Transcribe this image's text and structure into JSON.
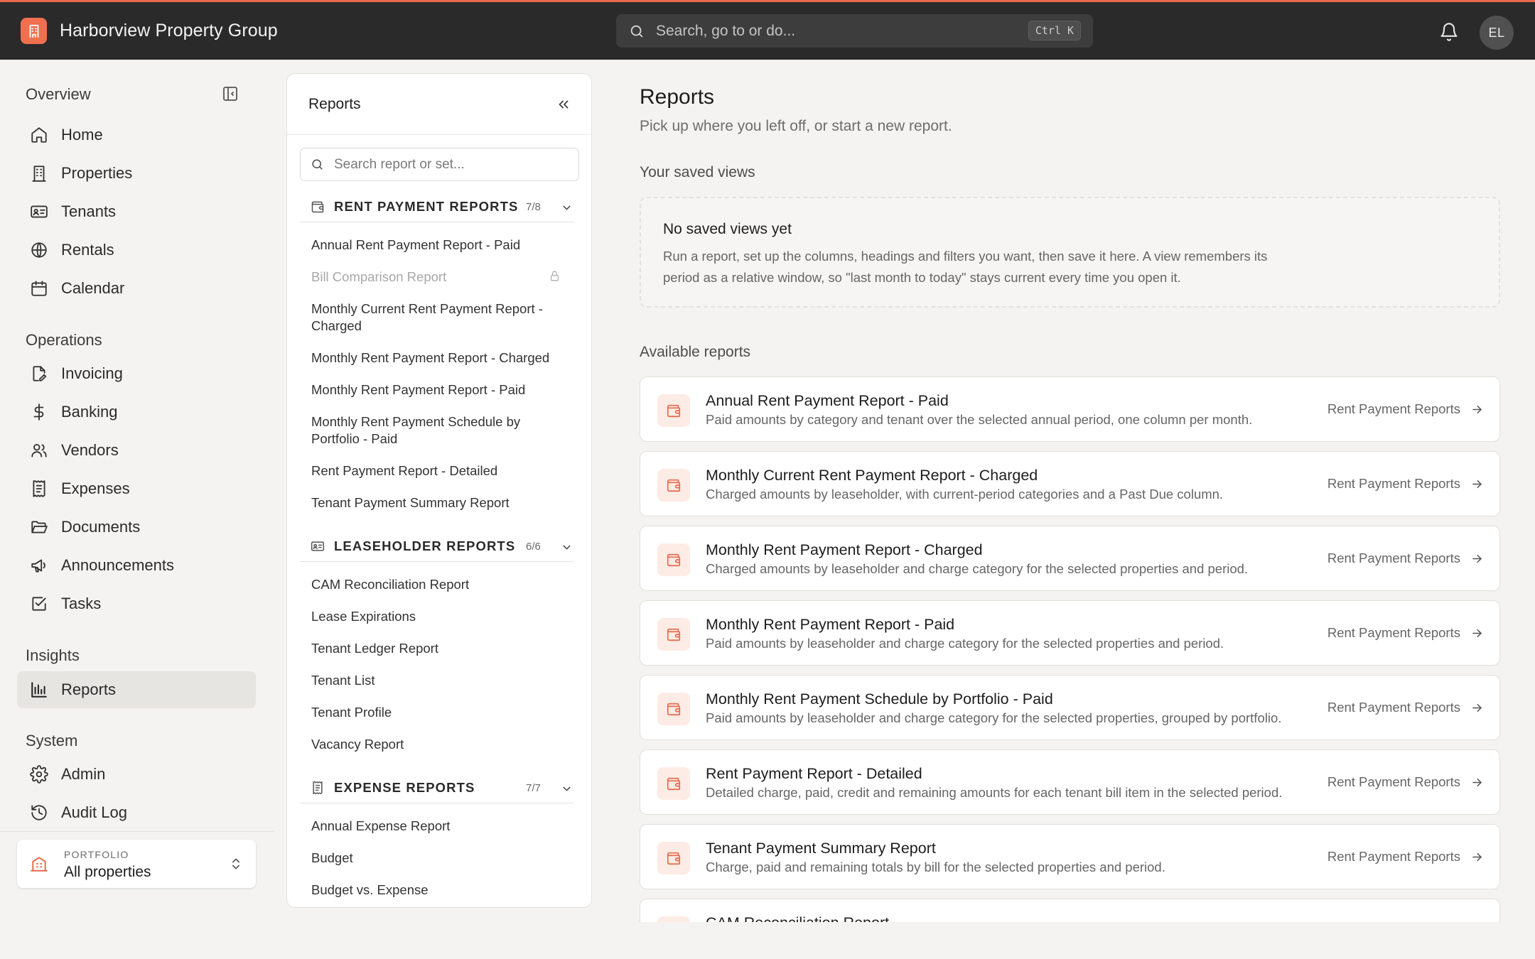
{
  "app": {
    "name": "Harborview Property Group",
    "search_placeholder": "Search, go to or do...",
    "search_shortcut": "Ctrl K",
    "user_initials": "EL",
    "accent_color": "#e8694a"
  },
  "sidebar": {
    "sections": {
      "overview": "Overview",
      "operations": "Operations",
      "insights": "Insights",
      "system": "System"
    },
    "items": {
      "home": "Home",
      "properties": "Properties",
      "tenants": "Tenants",
      "rentals": "Rentals",
      "calendar": "Calendar",
      "invoicing": "Invoicing",
      "banking": "Banking",
      "vendors": "Vendors",
      "expenses": "Expenses",
      "documents": "Documents",
      "announcements": "Announcements",
      "tasks": "Tasks",
      "reports": "Reports",
      "admin": "Admin",
      "audit_log": "Audit Log"
    },
    "active_item": "Reports",
    "portfolio": {
      "caption": "PORTFOLIO",
      "value": "All properties"
    }
  },
  "reports_panel": {
    "title": "Reports",
    "search_placeholder": "Search report or set...",
    "groups": [
      {
        "title": "RENT PAYMENT REPORTS",
        "count": "7/8",
        "icon": "wallet-icon",
        "items": [
          "Annual Rent Payment Report - Paid",
          "Bill Comparison Report",
          "Monthly Current Rent Payment Report - Charged",
          "Monthly Rent Payment Report - Charged",
          "Monthly Rent Payment Report - Paid",
          "Monthly Rent Payment Schedule by Portfolio - Paid",
          "Rent Payment Report - Detailed",
          "Tenant Payment Summary Report"
        ],
        "locked_item": "Bill Comparison Report"
      },
      {
        "title": "LEASEHOLDER REPORTS",
        "count": "6/6",
        "icon": "id-card-icon",
        "items": [
          "CAM Reconciliation Report",
          "Lease Expirations",
          "Tenant Ledger Report",
          "Tenant List",
          "Tenant Profile",
          "Vacancy Report"
        ]
      },
      {
        "title": "EXPENSE REPORTS",
        "count": "7/7",
        "icon": "receipt-icon",
        "items": [
          "Annual Expense Report",
          "Budget",
          "Budget vs. Expense"
        ]
      }
    ]
  },
  "main": {
    "title": "Reports",
    "subtitle": "Pick up where you left off, or start a new report.",
    "saved_views": {
      "heading": "Your saved views",
      "empty_title": "No saved views yet",
      "empty_desc": "Run a report, set up the columns, headings and filters you want, then save it here. A view remembers its period as a relative window, so \"last month to today\" stays current every time you open it."
    },
    "available": {
      "heading": "Available reports",
      "reports": [
        {
          "title": "Annual Rent Payment Report - Paid",
          "desc": "Paid amounts by category and tenant over the selected annual period, one column per month.",
          "category": "Rent Payment Reports"
        },
        {
          "title": "Monthly Current Rent Payment Report - Charged",
          "desc": "Charged amounts by leaseholder, with current-period categories and a Past Due column.",
          "category": "Rent Payment Reports"
        },
        {
          "title": "Monthly Rent Payment Report - Charged",
          "desc": "Charged amounts by leaseholder and charge category for the selected properties and period.",
          "category": "Rent Payment Reports"
        },
        {
          "title": "Monthly Rent Payment Report - Paid",
          "desc": "Paid amounts by leaseholder and charge category for the selected properties and period.",
          "category": "Rent Payment Reports"
        },
        {
          "title": "Monthly Rent Payment Schedule by Portfolio - Paid",
          "desc": "Paid amounts by leaseholder and charge category for the selected properties, grouped by portfolio.",
          "category": "Rent Payment Reports"
        },
        {
          "title": "Rent Payment Report - Detailed",
          "desc": "Detailed charge, paid, credit and remaining amounts for each tenant bill item in the selected period.",
          "category": "Rent Payment Reports"
        },
        {
          "title": "Tenant Payment Summary Report",
          "desc": "Charge, paid and remaining totals by bill for the selected properties and period.",
          "category": "Rent Payment Reports"
        },
        {
          "title": "CAM Reconciliation Report",
          "desc": "",
          "category": ""
        }
      ]
    }
  }
}
